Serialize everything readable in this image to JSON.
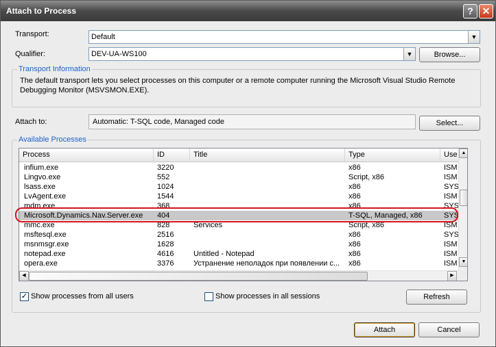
{
  "window": {
    "title": "Attach to Process",
    "help_glyph": "?",
    "close_glyph": "✕"
  },
  "transport": {
    "label": "Transport:",
    "value": "Default"
  },
  "qualifier": {
    "label": "Qualifier:",
    "value": "DEV-UA-WS100",
    "browse_label": "Browse..."
  },
  "transport_info": {
    "title": "Transport Information",
    "text": "The default transport lets you select processes on this computer or a remote computer running the Microsoft Visual Studio Remote Debugging Monitor (MSVSMON.EXE)."
  },
  "attach_to": {
    "label": "Attach to:",
    "value": "Automatic: T-SQL code, Managed code",
    "select_label": "Select..."
  },
  "available": {
    "title": "Available Processes",
    "columns": [
      "Process",
      "ID",
      "Title",
      "Type",
      "Use"
    ],
    "rows": [
      {
        "process": "infium.exe",
        "id": "3220",
        "title": "",
        "type": "x86",
        "user": "ISM"
      },
      {
        "process": "Lingvo.exe",
        "id": "552",
        "title": "",
        "type": "Script, x86",
        "user": "ISM"
      },
      {
        "process": "lsass.exe",
        "id": "1024",
        "title": "",
        "type": "x86",
        "user": "SYS"
      },
      {
        "process": "LvAgent.exe",
        "id": "1544",
        "title": "",
        "type": "x86",
        "user": "ISM"
      },
      {
        "process": "mdm.exe",
        "id": "368",
        "title": "",
        "type": "x86",
        "user": "SYS"
      },
      {
        "process": "Microsoft.Dynamics.Nav.Server.exe",
        "id": "404",
        "title": "",
        "type": "T-SQL, Managed, x86",
        "user": "SYS"
      },
      {
        "process": "mmc.exe",
        "id": "828",
        "title": "Services",
        "type": "Script, x86",
        "user": "ISM"
      },
      {
        "process": "msftesql.exe",
        "id": "2516",
        "title": "",
        "type": "x86",
        "user": "SYS"
      },
      {
        "process": "msnmsgr.exe",
        "id": "1628",
        "title": "",
        "type": "x86",
        "user": "ISM"
      },
      {
        "process": "notepad.exe",
        "id": "4616",
        "title": "Untitled - Notepad",
        "type": "x86",
        "user": "ISM"
      },
      {
        "process": "opera.exe",
        "id": "3376",
        "title": "Устранение неполадок при появлении с...",
        "type": "x86",
        "user": "ISM"
      }
    ],
    "selected_index": 5,
    "show_all_users": {
      "label": "Show processes from all users",
      "checked": true,
      "check_glyph": "✓"
    },
    "show_all_sessions": {
      "label": "Show processes in all sessions",
      "checked": false
    },
    "refresh_label": "Refresh"
  },
  "footer": {
    "attach_label": "Attach",
    "cancel_label": "Cancel"
  },
  "colors": {
    "highlight": "#d4141c",
    "group_title": "#1e5fc8",
    "selected_row": "#c8c8c8"
  }
}
